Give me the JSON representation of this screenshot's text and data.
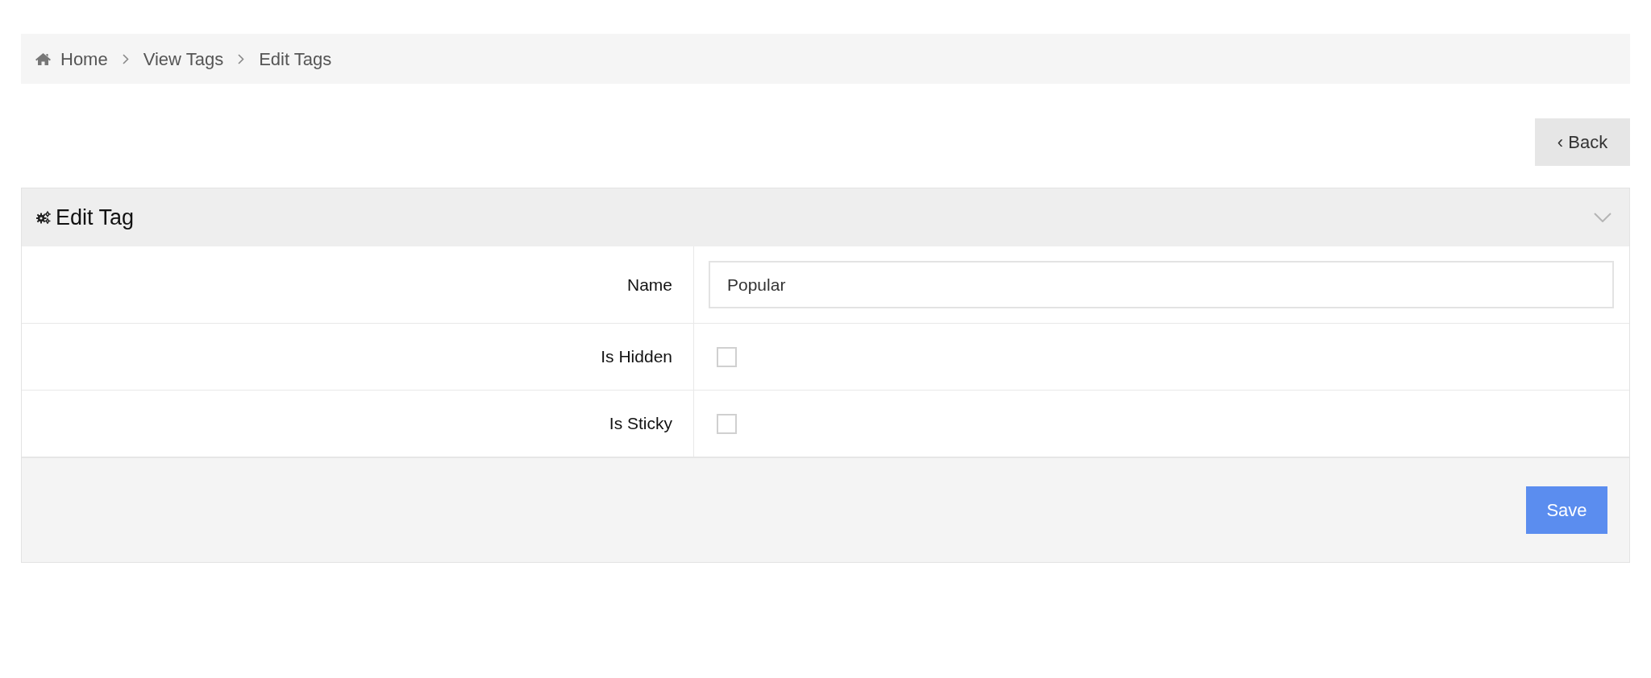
{
  "breadcrumb": [
    {
      "kind": "home",
      "label": "Home"
    },
    {
      "kind": "link",
      "label": "View Tags"
    },
    {
      "kind": "link",
      "label": "Edit Tags"
    }
  ],
  "back_button": {
    "label": "‹ Back"
  },
  "panel": {
    "title": "Edit Tag",
    "rows": [
      {
        "kind": "text",
        "label": "Name",
        "value": "Popular"
      },
      {
        "kind": "checkbox",
        "label": "Is Hidden",
        "checked": false
      },
      {
        "kind": "checkbox",
        "label": "Is Sticky",
        "checked": false
      }
    ],
    "save_button": {
      "label": "Save"
    }
  }
}
